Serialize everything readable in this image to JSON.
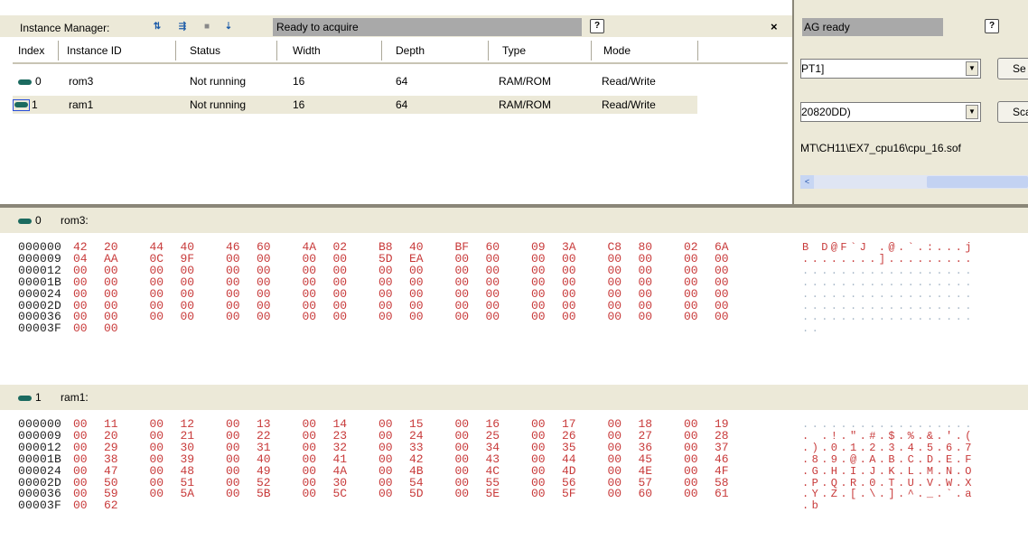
{
  "instance_manager": {
    "title": "Instance Manager:",
    "status": "Ready to acquire",
    "help_label": "?",
    "close_label": "×",
    "toolbar_icons": [
      "auto-run-icon",
      "run-icon",
      "stop-icon",
      "sort-icon"
    ],
    "columns": [
      "Index",
      "Instance ID",
      "Status",
      "Width",
      "Depth",
      "Type",
      "Mode"
    ],
    "rows": [
      {
        "index": "0",
        "id": "rom3",
        "status": "Not running",
        "width": "16",
        "depth": "64",
        "type": "RAM/ROM",
        "mode": "Read/Write"
      },
      {
        "index": "1",
        "id": "ram1",
        "status": "Not running",
        "width": "16",
        "depth": "64",
        "type": "RAM/ROM",
        "mode": "Read/Write"
      }
    ]
  },
  "jtag": {
    "status": "AG ready",
    "help_label": "?",
    "hardware_value": "PT1]",
    "hardware_button": "Se",
    "device_value": "20820DD)",
    "device_button": "Sca",
    "file_path": "MT\\CH11\\EX7_cpu16\\cpu_16.sof",
    "scroll_left": "<"
  },
  "memory": {
    "sections": [
      {
        "index": "0",
        "label": "rom3:",
        "rows": [
          {
            "addr": "000000",
            "bytes": [
              "42",
              "20",
              "44",
              "40",
              "46",
              "60",
              "4A",
              "02",
              "B8",
              "40",
              "BF",
              "60",
              "09",
              "3A",
              "C8",
              "80",
              "02",
              "6A"
            ],
            "ascii": "B D@F`J .@.`.:...j"
          },
          {
            "addr": "000009",
            "bytes": [
              "04",
              "AA",
              "0C",
              "9F",
              "00",
              "00",
              "00",
              "00",
              "5D",
              "EA",
              "00",
              "00",
              "00",
              "00",
              "00",
              "00",
              "00",
              "00"
            ],
            "ascii": "........]........."
          },
          {
            "addr": "000012",
            "bytes": [
              "00",
              "00",
              "00",
              "00",
              "00",
              "00",
              "00",
              "00",
              "00",
              "00",
              "00",
              "00",
              "00",
              "00",
              "00",
              "00",
              "00",
              "00"
            ],
            "ascii": ".................."
          },
          {
            "addr": "00001B",
            "bytes": [
              "00",
              "00",
              "00",
              "00",
              "00",
              "00",
              "00",
              "00",
              "00",
              "00",
              "00",
              "00",
              "00",
              "00",
              "00",
              "00",
              "00",
              "00"
            ],
            "ascii": ".................."
          },
          {
            "addr": "000024",
            "bytes": [
              "00",
              "00",
              "00",
              "00",
              "00",
              "00",
              "00",
              "00",
              "00",
              "00",
              "00",
              "00",
              "00",
              "00",
              "00",
              "00",
              "00",
              "00"
            ],
            "ascii": ".................."
          },
          {
            "addr": "00002D",
            "bytes": [
              "00",
              "00",
              "00",
              "00",
              "00",
              "00",
              "00",
              "00",
              "00",
              "00",
              "00",
              "00",
              "00",
              "00",
              "00",
              "00",
              "00",
              "00"
            ],
            "ascii": ".................."
          },
          {
            "addr": "000036",
            "bytes": [
              "00",
              "00",
              "00",
              "00",
              "00",
              "00",
              "00",
              "00",
              "00",
              "00",
              "00",
              "00",
              "00",
              "00",
              "00",
              "00",
              "00",
              "00"
            ],
            "ascii": ".................."
          },
          {
            "addr": "00003F",
            "bytes": [
              "00",
              "00"
            ],
            "ascii": ".."
          }
        ]
      },
      {
        "index": "1",
        "label": "ram1:",
        "rows": [
          {
            "addr": "000000",
            "bytes": [
              "00",
              "11",
              "00",
              "12",
              "00",
              "13",
              "00",
              "14",
              "00",
              "15",
              "00",
              "16",
              "00",
              "17",
              "00",
              "18",
              "00",
              "19"
            ],
            "ascii": ".................."
          },
          {
            "addr": "000009",
            "bytes": [
              "00",
              "20",
              "00",
              "21",
              "00",
              "22",
              "00",
              "23",
              "00",
              "24",
              "00",
              "25",
              "00",
              "26",
              "00",
              "27",
              "00",
              "28"
            ],
            "ascii": ". .!.\".#.$.%.&.'.("
          },
          {
            "addr": "000012",
            "bytes": [
              "00",
              "29",
              "00",
              "30",
              "00",
              "31",
              "00",
              "32",
              "00",
              "33",
              "00",
              "34",
              "00",
              "35",
              "00",
              "36",
              "00",
              "37"
            ],
            "ascii": ".).0.1.2.3.4.5.6.7"
          },
          {
            "addr": "00001B",
            "bytes": [
              "00",
              "38",
              "00",
              "39",
              "00",
              "40",
              "00",
              "41",
              "00",
              "42",
              "00",
              "43",
              "00",
              "44",
              "00",
              "45",
              "00",
              "46"
            ],
            "ascii": ".8.9.@.A.B.C.D.E.F"
          },
          {
            "addr": "000024",
            "bytes": [
              "00",
              "47",
              "00",
              "48",
              "00",
              "49",
              "00",
              "4A",
              "00",
              "4B",
              "00",
              "4C",
              "00",
              "4D",
              "00",
              "4E",
              "00",
              "4F"
            ],
            "ascii": ".G.H.I.J.K.L.M.N.O"
          },
          {
            "addr": "00002D",
            "bytes": [
              "00",
              "50",
              "00",
              "51",
              "00",
              "52",
              "00",
              "30",
              "00",
              "54",
              "00",
              "55",
              "00",
              "56",
              "00",
              "57",
              "00",
              "58"
            ],
            "ascii": ".P.Q.R.0.T.U.V.W.X"
          },
          {
            "addr": "000036",
            "bytes": [
              "00",
              "59",
              "00",
              "5A",
              "00",
              "5B",
              "00",
              "5C",
              "00",
              "5D",
              "00",
              "5E",
              "00",
              "5F",
              "00",
              "60",
              "00",
              "61"
            ],
            "ascii": ".Y.Z.[.\\.].^._.`.a"
          },
          {
            "addr": "00003F",
            "bytes": [
              "00",
              "62"
            ],
            "ascii": ".b"
          }
        ]
      }
    ]
  }
}
